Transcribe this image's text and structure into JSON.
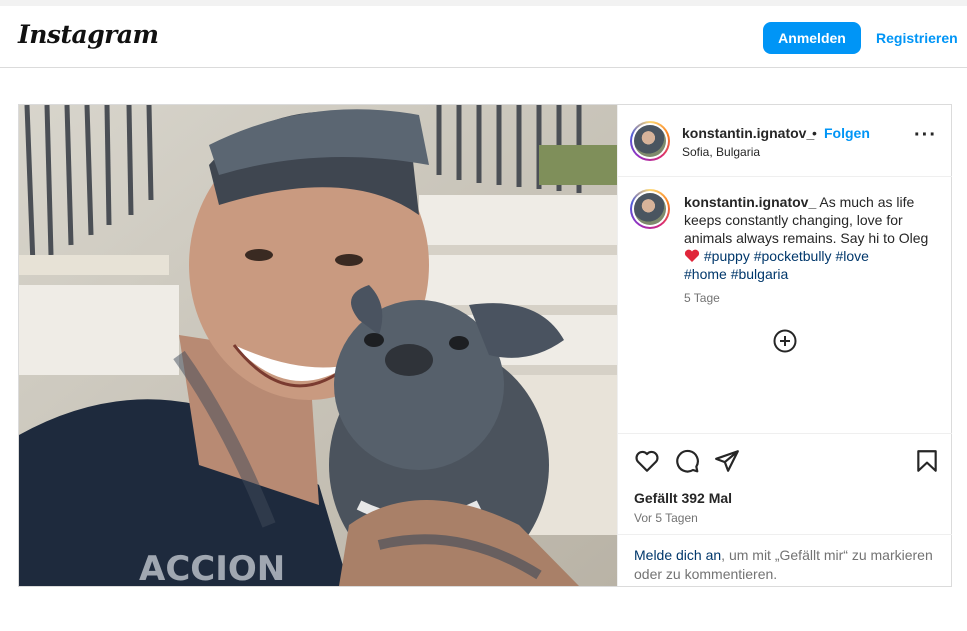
{
  "header": {
    "logo": "Instagram",
    "login_label": "Anmelden",
    "register_label": "Registrieren"
  },
  "post": {
    "username": "konstantin.ignatov_",
    "separator": "•",
    "follow_label": "Folgen",
    "location": "Sofia, Bulgaria",
    "caption_text": "As much as life keeps constantly changing, love for animals always remains. Say hi to Oleg",
    "hashtags": [
      "#puppy",
      "#pocketbully",
      "#love",
      "#home",
      "#bulgaria"
    ],
    "caption_time": "5 Tage",
    "likes": "Gefällt 392 Mal",
    "date": "Vor 5 Tagen",
    "login_prompt_link": "Melde dich an",
    "login_prompt_text": ", um mit „Gefällt mir“ zu markieren oder zu kommentieren."
  },
  "icons": {
    "more": "more-options-icon",
    "add_comment": "plus-circle-icon",
    "like": "heart-icon",
    "comment": "comment-icon",
    "share": "share-icon",
    "save": "bookmark-icon",
    "caption_emoji": "red-heart-emoji"
  },
  "colors": {
    "accent": "#0095f6",
    "hashtag": "#00376b",
    "muted": "#737373",
    "border": "#dbdbdb"
  }
}
